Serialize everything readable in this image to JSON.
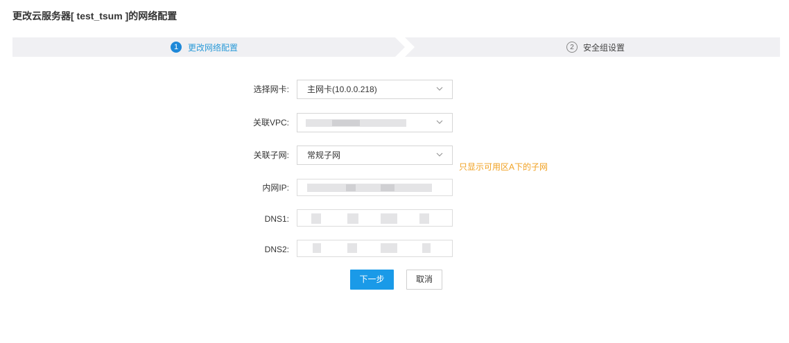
{
  "page_title": "更改云服务器[ test_tsum ]的网络配置",
  "steps": [
    {
      "num": "1",
      "label": "更改网络配置",
      "active": true
    },
    {
      "num": "2",
      "label": "安全组设置",
      "active": false
    }
  ],
  "form": {
    "nic": {
      "label": "选择网卡:",
      "value": "主网卡(10.0.0.218)"
    },
    "vpc": {
      "label": "关联VPC:",
      "value": ""
    },
    "subnet": {
      "label": "关联子网:",
      "value": "常规子网",
      "hint": "只显示可用区A下的子网"
    },
    "private_ip": {
      "label": "内网IP:",
      "value": ""
    },
    "dns1": {
      "label": "DNS1:",
      "value": ""
    },
    "dns2": {
      "label": "DNS2:",
      "value": ""
    }
  },
  "buttons": {
    "next": "下一步",
    "cancel": "取消"
  },
  "colors": {
    "primary": "#1a9ae8",
    "hint": "#f0a020",
    "step_bar": "#f0f0f3"
  }
}
